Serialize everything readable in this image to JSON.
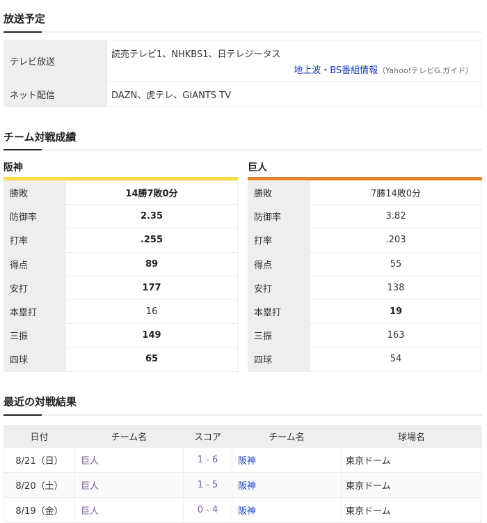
{
  "broadcast": {
    "title": "放送予定",
    "tv_label": "テレビ放送",
    "tv_value": "読売テレビ1、NHKBS1、日テレジータス",
    "tv_link": "地上波・BS番組情報",
    "tv_link_note": "（Yahoo!テレビG.ガイド）",
    "net_label": "ネット配信",
    "net_value": "DAZN、虎テレ、GIANTS TV"
  },
  "stats": {
    "title": "チーム対戦成績",
    "teams": [
      {
        "name": "阪神",
        "color": "#f9dc3f",
        "rows": [
          [
            "勝敗",
            "14勝7敗0分",
            true
          ],
          [
            "防御率",
            "2.35",
            true
          ],
          [
            "打率",
            ".255",
            true
          ],
          [
            "得点",
            "89",
            true
          ],
          [
            "安打",
            "177",
            true
          ],
          [
            "本塁打",
            "16",
            false
          ],
          [
            "三振",
            "149",
            true
          ],
          [
            "四球",
            "65",
            true
          ]
        ]
      },
      {
        "name": "巨人",
        "color": "#e8832a",
        "rows": [
          [
            "勝敗",
            "7勝14敗0分",
            false
          ],
          [
            "防御率",
            "3.82",
            false
          ],
          [
            "打率",
            ".203",
            false
          ],
          [
            "得点",
            "55",
            false
          ],
          [
            "安打",
            "138",
            false
          ],
          [
            "本塁打",
            "19",
            true
          ],
          [
            "三振",
            "163",
            false
          ],
          [
            "四球",
            "54",
            false
          ]
        ]
      }
    ]
  },
  "results": {
    "title": "最近の対戦結果",
    "headers": [
      "日付",
      "チーム名",
      "スコア",
      "チーム名",
      "球場名"
    ],
    "rows": [
      [
        "8/21（日）",
        "巨人",
        "1 - 6",
        "阪神",
        "東京ドーム"
      ],
      [
        "8/20（土）",
        "巨人",
        "1 - 5",
        "阪神",
        "東京ドーム"
      ],
      [
        "8/19（金）",
        "巨人",
        "0 - 4",
        "阪神",
        "東京ドーム"
      ]
    ]
  }
}
